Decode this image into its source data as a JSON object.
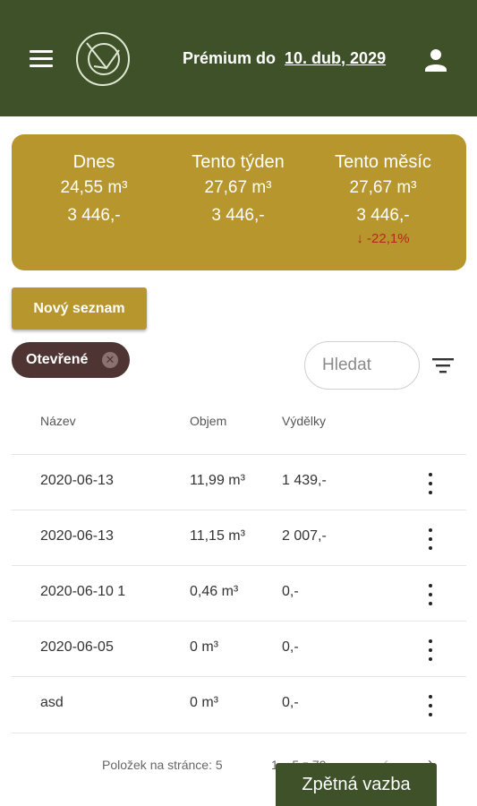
{
  "header": {
    "premium_label": "Prémium do",
    "premium_date": "10. dub, 2029",
    "menu_icon": "menu-icon",
    "user_icon": "account-icon",
    "logo_icon": "app-logo"
  },
  "stats": {
    "today": {
      "label": "Dnes",
      "volume": "24,55 m³",
      "earnings": "3 446,-"
    },
    "week": {
      "label": "Tento týden",
      "volume": "27,67 m³",
      "earnings": "3 446,-"
    },
    "month": {
      "label": "Tento měsíc",
      "volume": "27,67 m³",
      "earnings": "3 446,-",
      "change": "↓ -22,1%"
    }
  },
  "actions": {
    "new_list": "Nový seznam"
  },
  "filter_chip": {
    "label": "Otevřené"
  },
  "search": {
    "placeholder": "Hledat",
    "value": ""
  },
  "table": {
    "headers": {
      "name": "Název",
      "volume": "Objem",
      "earnings": "Výdělky"
    },
    "rows": [
      {
        "name": "2020-06-13",
        "volume": "11,99 m³",
        "earnings": "1 439,-"
      },
      {
        "name": "2020-06-13",
        "volume": "11,15 m³",
        "earnings": "2 007,-"
      },
      {
        "name": "2020-06-10 1",
        "volume": "0,46 m³",
        "earnings": "0,-"
      },
      {
        "name": "2020-06-05",
        "volume": "0 m³",
        "earnings": "0,-"
      },
      {
        "name": "asd",
        "volume": "0 m³",
        "earnings": "0,-"
      }
    ]
  },
  "pagination": {
    "per_page_label": "Položek na stránce: 5",
    "range": "1 – 5 z 79",
    "prev": "‹",
    "next": "›"
  },
  "feedback": {
    "label": "Zpětná vazba"
  },
  "colors": {
    "header": "#3e5128",
    "accent": "#b8962e",
    "chip": "#4e3533",
    "negative": "#b22a1a"
  }
}
